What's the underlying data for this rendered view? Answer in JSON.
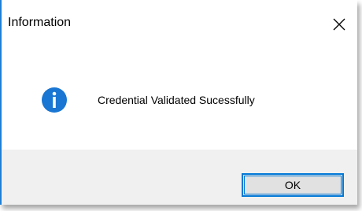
{
  "dialog": {
    "title": "Information",
    "close_icon": "close-icon",
    "message_icon": "info-icon",
    "message": "Credential Validated Sucessfully",
    "ok_label": "OK"
  },
  "colors": {
    "accent_border": "#1f7fd6",
    "info_icon_fill": "#1976d2",
    "footer_bg": "#f0f0f0",
    "button_bg": "#e1e1e1",
    "button_border": "#0078d7"
  }
}
